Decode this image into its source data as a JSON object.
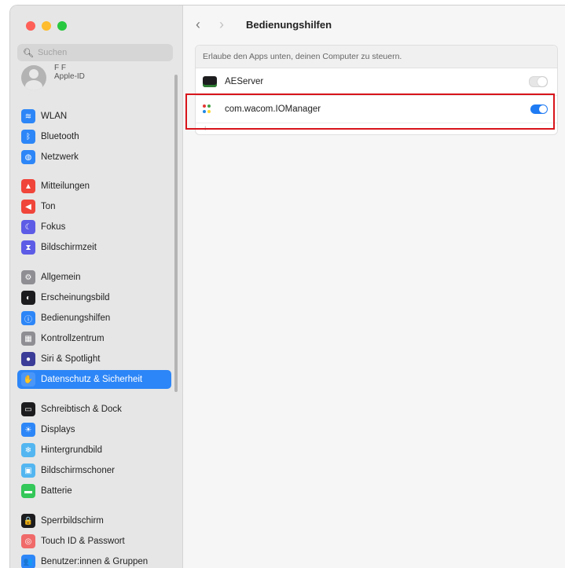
{
  "sidebar": {
    "search_placeholder": "Suchen",
    "profile": {
      "initials": "F F",
      "subtitle": "Apple-ID"
    },
    "items": [
      {
        "label": "WLAN",
        "icon": "wifi-icon",
        "color": "#2d86f7"
      },
      {
        "label": "Bluetooth",
        "icon": "bluetooth-icon",
        "color": "#2d86f7"
      },
      {
        "label": "Netzwerk",
        "icon": "globe-icon",
        "color": "#2d86f7"
      },
      {
        "label": "Mitteilungen",
        "icon": "bell-icon",
        "color": "#f0453a"
      },
      {
        "label": "Ton",
        "icon": "speaker-icon",
        "color": "#f0453a"
      },
      {
        "label": "Fokus",
        "icon": "moon-icon",
        "color": "#5d5ce6"
      },
      {
        "label": "Bildschirmzeit",
        "icon": "hourglass-icon",
        "color": "#5d5ce6"
      },
      {
        "label": "Allgemein",
        "icon": "gear-icon",
        "color": "#8e8e93"
      },
      {
        "label": "Erscheinungsbild",
        "icon": "appearance-icon",
        "color": "#1c1c1e"
      },
      {
        "label": "Bedienungshilfen",
        "icon": "accessibility-icon",
        "color": "#2d86f7"
      },
      {
        "label": "Kontrollzentrum",
        "icon": "control-center-icon",
        "color": "#8e8e93"
      },
      {
        "label": "Siri & Spotlight",
        "icon": "siri-icon",
        "color": "#3b3b98"
      },
      {
        "label": "Datenschutz & Sicherheit",
        "icon": "hand-icon",
        "color": "#2d86f7",
        "selected": true
      },
      {
        "label": "Schreibtisch & Dock",
        "icon": "dock-icon",
        "color": "#1c1c1e"
      },
      {
        "label": "Displays",
        "icon": "sun-icon",
        "color": "#2d86f7"
      },
      {
        "label": "Hintergrundbild",
        "icon": "snowflake-icon",
        "color": "#53b6f0"
      },
      {
        "label": "Bildschirmschoner",
        "icon": "screensaver-icon",
        "color": "#53b6f0"
      },
      {
        "label": "Batterie",
        "icon": "battery-icon",
        "color": "#34c759"
      },
      {
        "label": "Sperrbildschirm",
        "icon": "lock-icon",
        "color": "#1c1c1e"
      },
      {
        "label": "Touch ID & Passwort",
        "icon": "fingerprint-icon",
        "color": "#f06a6a"
      },
      {
        "label": "Benutzer:innen & Gruppen",
        "icon": "users-icon",
        "color": "#2d86f7"
      }
    ]
  },
  "header": {
    "back": "‹",
    "forward": "›",
    "title": "Bedienungshilfen"
  },
  "panel": {
    "description": "Erlaube den Apps unten, deinen Computer zu steuern.",
    "apps": [
      {
        "name": "AEServer",
        "enabled": false
      },
      {
        "name": "com.wacom.IOManager",
        "enabled": true
      }
    ],
    "add": "+",
    "remove": "−"
  }
}
